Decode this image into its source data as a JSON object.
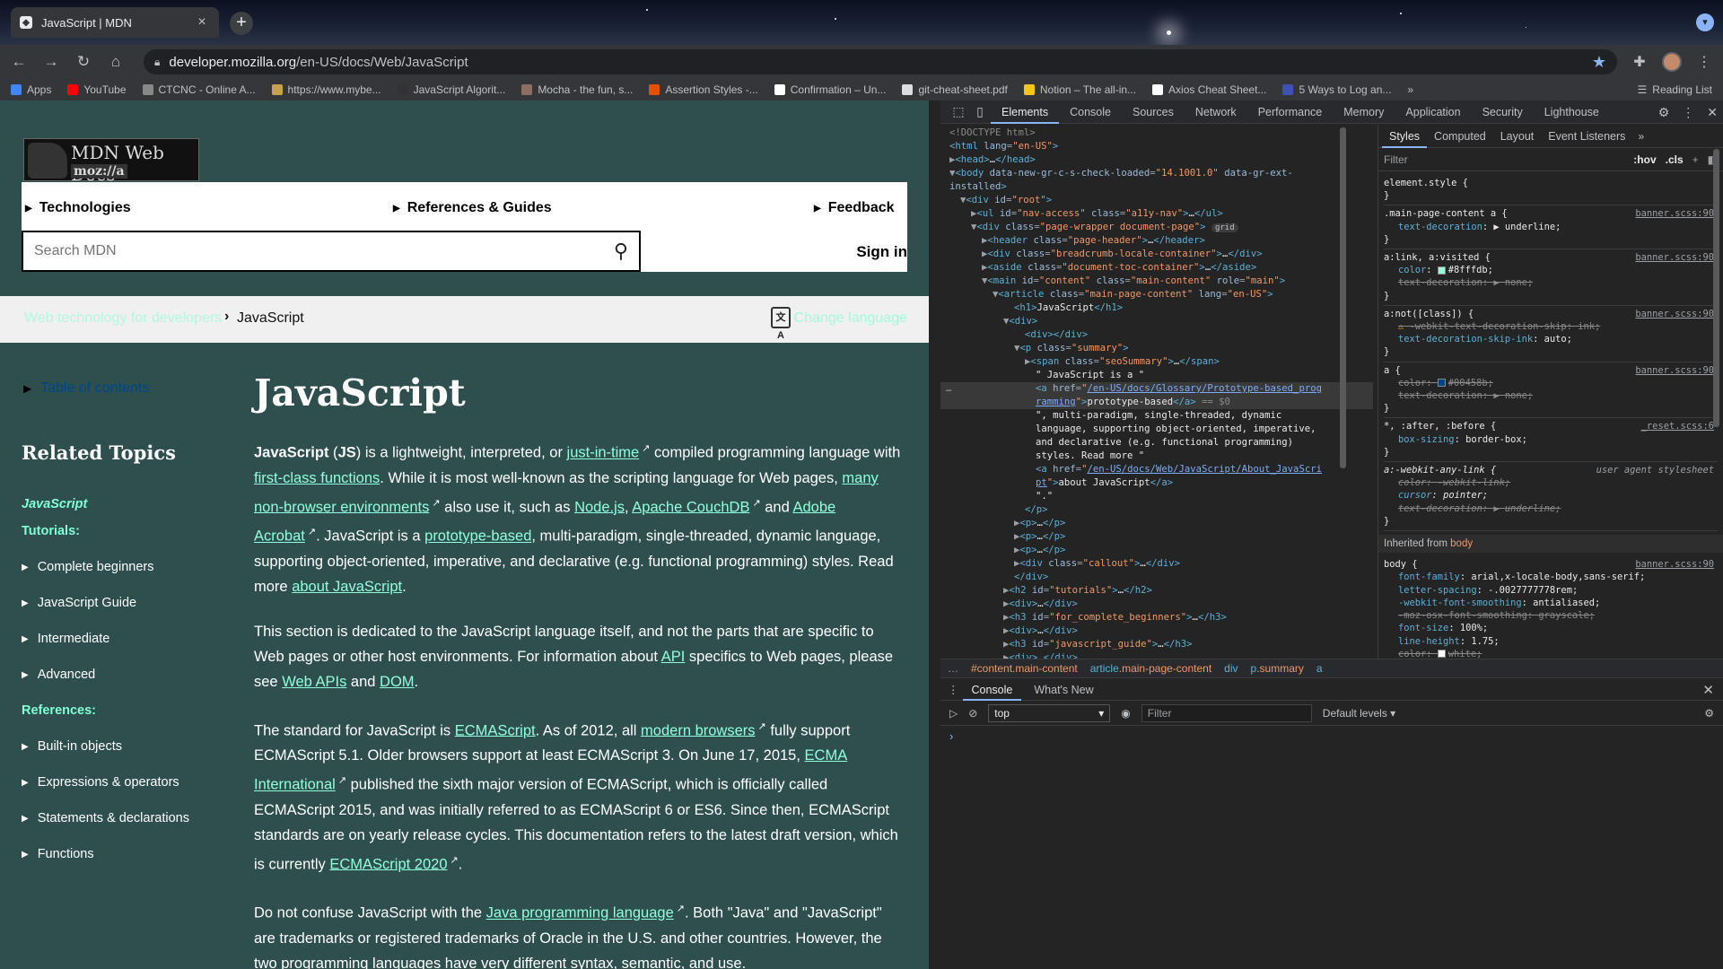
{
  "browser": {
    "tab_title": "JavaScript | MDN",
    "url_domain": "developer.mozilla.org",
    "url_path": "/en-US/docs/Web/JavaScript",
    "bookmarks": [
      {
        "label": "Apps",
        "color": "#4285f4"
      },
      {
        "label": "YouTube",
        "color": "#ff0000"
      },
      {
        "label": "CTCNC - Online A...",
        "color": "#888888"
      },
      {
        "label": "https://www.mybe...",
        "color": "#c8a050"
      },
      {
        "label": "JavaScript Algorit...",
        "color": "#333333"
      },
      {
        "label": "Mocha - the fun, s...",
        "color": "#8d6e63"
      },
      {
        "label": "Assertion Styles -...",
        "color": "#e65100"
      },
      {
        "label": "Confirmation – Un...",
        "color": "#ffffff"
      },
      {
        "label": "git-cheat-sheet.pdf",
        "color": "#dddddd"
      },
      {
        "label": "Notion – The all-in...",
        "color": "#f5c518"
      },
      {
        "label": "Axios Cheat Sheet...",
        "color": "#ffffff"
      },
      {
        "label": "5 Ways to Log an...",
        "color": "#3f51b5"
      }
    ],
    "reading_list": "Reading List"
  },
  "mdn": {
    "logo_text": "MDN Web Docs",
    "logo_sub": "moz://a",
    "menu": [
      "Technologies",
      "References & Guides",
      "Feedback"
    ],
    "search_placeholder": "Search MDN",
    "sign_in": "Sign in",
    "breadcrumb": [
      "Web technology for developers",
      "JavaScript"
    ],
    "change_language": "Change language",
    "toc": "Table of contents",
    "related_title": "Related Topics",
    "sidebar": {
      "javascript": "JavaScript",
      "tutorials": "Tutorials:",
      "tutorial_items": [
        "Complete beginners",
        "JavaScript Guide",
        "Intermediate",
        "Advanced"
      ],
      "references": "References:",
      "reference_items": [
        "Built-in objects",
        "Expressions & operators",
        "Statements & declarations",
        "Functions"
      ]
    },
    "title": "JavaScript",
    "p1": {
      "a": "JavaScript",
      "b": " (",
      "c": "JS",
      "d": ") is a lightweight, interpreted, or ",
      "l1": "just-in-time",
      "e": " compiled programming language with ",
      "l2": "first-class functions",
      "f": ". While it is most well-known as the scripting language for Web pages, ",
      "l3": "many non-browser environments",
      "g": " also use it, such as ",
      "l4": "Node.js",
      "h": ", ",
      "l5": "Apache CouchDB",
      "i": " and ",
      "l6": "Adobe Acrobat",
      "j": ". JavaScript is a ",
      "l7": "prototype-based",
      "k": ", multi-paradigm, single-threaded, dynamic language, supporting object-oriented, imperative, and declarative (e.g. functional programming) styles. Read more ",
      "l8": "about JavaScript",
      "m": "."
    },
    "p2": {
      "a": "This section is dedicated to the JavaScript language itself, and not the parts that are specific to Web pages or other host environments. For information about ",
      "l1": "API",
      "b": " specifics to Web pages, please see ",
      "l2": "Web APIs",
      "c": " and ",
      "l3": "DOM",
      "d": "."
    },
    "p3": {
      "a": "The standard for JavaScript is ",
      "l1": "ECMAScript",
      "b": ". As of 2012, all ",
      "l2": "modern browsers",
      "c": " fully support ECMAScript 5.1. Older browsers support at least ECMAScript 3. On June 17, 2015, ",
      "l3": "ECMA International",
      "d": " published the sixth major version of ECMAScript, which is officially called ECMAScript 2015, and was initially referred to as ECMAScript 6 or ES6. Since then, ECMAScript standards are on yearly release cycles. This documentation refers to the latest draft version, which is currently ",
      "l4": "ECMAScript 2020",
      "e": "."
    },
    "p4": {
      "a": "Do not confuse JavaScript with the ",
      "l1": "Java programming language",
      "b": ". Both \"Java\" and \"JavaScript\" are trademarks or registered trademarks of Oracle in the U.S. and other countries. However, the two programming languages have very different syntax, semantic, and use."
    }
  },
  "devtools": {
    "tabs": [
      "Elements",
      "Console",
      "Sources",
      "Network",
      "Performance",
      "Memory",
      "Application",
      "Security",
      "Lighthouse"
    ],
    "active_tab": "Elements",
    "style_tabs": [
      "Styles",
      "Computed",
      "Layout",
      "Event Listeners"
    ],
    "style_filter": "Filter",
    "hov": ":hov",
    "cls": ".cls",
    "inherited": "Inherited from",
    "inherited_tag": "body",
    "user_agent": "user agent stylesheet",
    "crumbs": [
      {
        "tag": "",
        "cls": "#content.main-content"
      },
      {
        "tag": "article",
        "cls": ".main-page-content"
      },
      {
        "tag": "div",
        "cls": ""
      },
      {
        "tag": "p",
        "cls": ".summary"
      },
      {
        "tag": "a",
        "cls": ""
      }
    ],
    "drawer_tabs": [
      "Console",
      "What's New"
    ],
    "context": "top",
    "console_filter": "Filter",
    "levels": "Default levels"
  }
}
